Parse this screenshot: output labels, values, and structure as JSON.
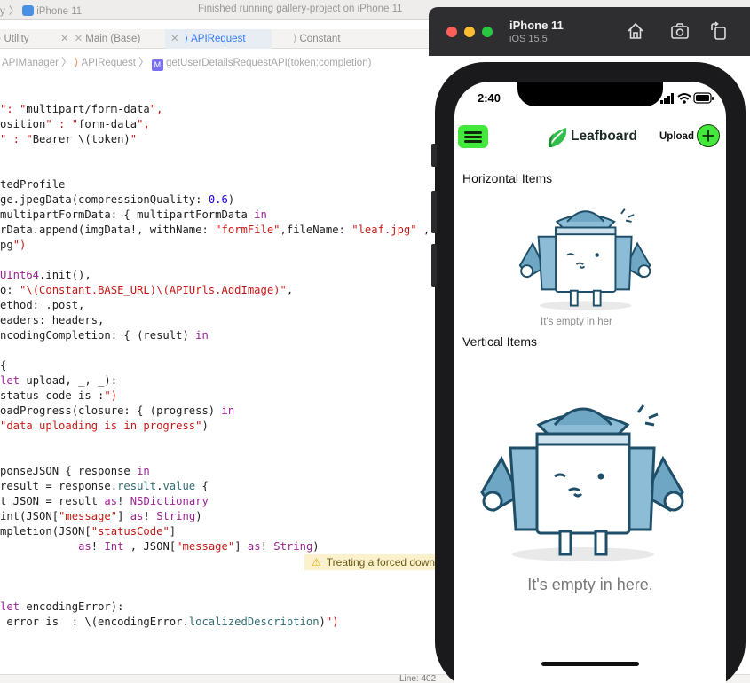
{
  "xcode": {
    "toolbar": {
      "scheme_fragment": "y",
      "device": "iPhone 11",
      "status": "Finished running gallery-project on iPhone 11"
    },
    "tabs": [
      {
        "label": "Utility"
      },
      {
        "label": "Main (Base)"
      },
      {
        "label": "APIRequest",
        "active": true
      },
      {
        "label": "Constant"
      }
    ],
    "jumpbar": {
      "items": [
        "APIManager",
        "APIRequest",
        "getUserDetailsRequestAPI(token:completion)"
      ]
    },
    "code_lines": [
      "\": \"multipart/form-data\",",
      "osition\" : \"form-data\",",
      "\" : \"Bearer \\(token)\"",
      "",
      "",
      "tedProfile",
      "ge.jpegData(compressionQuality: 0.6)",
      "multipartFormData: { multipartFormData in",
      "rData.append(imgData!, withName: \"formFile\",fileName: \"leaf.jpg\" , mi",
      "pg\")",
      "",
      "UInt64.init(),",
      "o: \"\\(Constant.BASE_URL)\\(APIUrls.AddImage)\",",
      "ethod: .post,",
      "eaders: headers,",
      "ncodingCompletion: { (result) in",
      "",
      "{",
      "let upload, _, _):",
      "status code is :\")",
      "oadProgress(closure: { (progress) in",
      "\"data uploading is in progress\")",
      "",
      "",
      "ponseJSON { response in",
      "result = response.result.value {",
      "t JSON = result as! NSDictionary",
      "int(JSON[\"message\"] as! String)",
      "mpletion(JSON[\"statusCode\"]",
      "            as! Int , JSON[\"message\"] as! String)",
      "",
      "",
      "",
      "let encodingError):",
      " error is  : \\(encodingError.localizedDescription)\")"
    ],
    "warning": "Treating a forced downcast",
    "status_line": "Line: 402"
  },
  "simulator": {
    "device_name": "iPhone 11",
    "os_version": "iOS 15.5",
    "buttons": [
      "home",
      "screenshot",
      "rotate"
    ]
  },
  "app": {
    "time": "2:40",
    "brand": "Leafboard",
    "upload_label": "Upload",
    "horizontal_title": "Horizontal Items",
    "vertical_title": "Vertical Items",
    "empty_text": "It's empty in here.",
    "accent_color": "#44e83c"
  }
}
